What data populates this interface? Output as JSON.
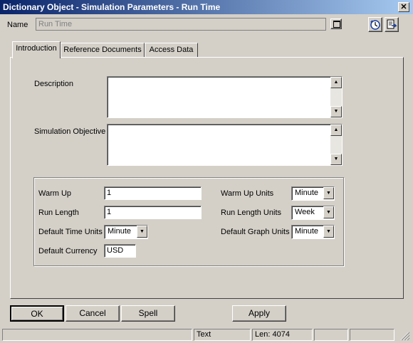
{
  "window": {
    "title": "Dictionary Object - Simulation Parameters - Run Time"
  },
  "name_field": {
    "label": "Name",
    "value": "Run Time"
  },
  "tabs": [
    {
      "label": "Introduction",
      "active": true
    },
    {
      "label": "Reference Documents",
      "active": false
    },
    {
      "label": "Access Data",
      "active": false
    }
  ],
  "fields": {
    "description": {
      "label": "Description",
      "value": ""
    },
    "objective": {
      "label": "Simulation Objective",
      "value": ""
    }
  },
  "params": {
    "warm_up": {
      "label": "Warm Up",
      "value": "1"
    },
    "run_length": {
      "label": "Run Length",
      "value": "1"
    },
    "default_time_units": {
      "label": "Default Time Units",
      "value": "Minute"
    },
    "default_currency": {
      "label": "Default Currency",
      "value": "USD"
    },
    "warm_up_units": {
      "label": "Warm Up Units",
      "value": "Minute"
    },
    "run_length_units": {
      "label": "Run Length Units",
      "value": "Week"
    },
    "default_graph_units": {
      "label": "Default Graph Units",
      "value": "Minute"
    }
  },
  "buttons": {
    "ok": "OK",
    "cancel": "Cancel",
    "spell": "Spell",
    "apply": "Apply"
  },
  "statusbar": {
    "mode": "Text",
    "length": "Len: 4074"
  },
  "icons": {
    "close": "close-icon",
    "maximize": "maximize-icon",
    "history": "clock-history-icon",
    "export": "export-document-icon",
    "scroll_up": "scroll-up-arrow-icon",
    "scroll_down": "scroll-down-arrow-icon",
    "dropdown": "dropdown-arrow-icon"
  },
  "colors": {
    "titlebar_start": "#0a246a",
    "titlebar_end": "#a6caf0",
    "face": "#d4d0c8"
  }
}
